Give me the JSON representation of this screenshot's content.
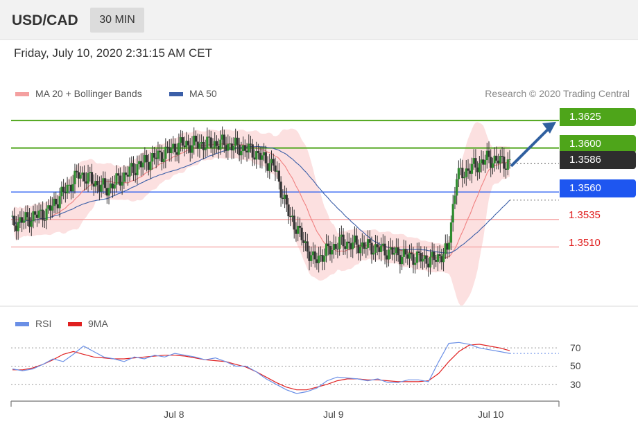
{
  "header": {
    "symbol": "USD/CAD",
    "timeframe": "30 MIN",
    "datetime": "Friday, July 10, 2020 2:31:15 AM CET"
  },
  "legend": {
    "ma20_label": "MA 20 + Bollinger Bands",
    "ma50_label": "MA 50",
    "copyright": "Research © 2020 Trading Central"
  },
  "colors": {
    "up_candle": "#2e8b2e",
    "down_candle": "#333333",
    "bollinger_fill": "#fcdada",
    "ma20": "#f08080",
    "ma50": "#3b5fa8",
    "resistance": "#4ea51a",
    "pivot": "#1e56f0",
    "support": "#f4a0a0",
    "last_price_tag": "#2e2e2e",
    "arrow": "#2f5f9f",
    "rsi": "#6a8fe6",
    "rsi_ma": "#e02020"
  },
  "levels": [
    {
      "label": "1.3625",
      "kind": "resistance"
    },
    {
      "label": "1.3600",
      "kind": "resistance"
    },
    {
      "label": "1.3586",
      "kind": "last"
    },
    {
      "label": "1.3560",
      "kind": "pivot"
    },
    {
      "label": "1.3535",
      "kind": "support"
    },
    {
      "label": "1.3510",
      "kind": "support"
    }
  ],
  "rsi_panel": {
    "rsi_label": "RSI",
    "ma_label": "9MA",
    "ticks": [
      "70",
      "50",
      "30"
    ]
  },
  "x_axis": {
    "ticks": [
      "Jul 8",
      "Jul 9",
      "Jul 10"
    ]
  },
  "chart_data": {
    "type": "candlestick",
    "instrument": "USD/CAD",
    "interval": "30 MIN",
    "ylim": [
      1.347,
      1.3635
    ],
    "levels": {
      "resistance": [
        1.3625,
        1.36
      ],
      "last": 1.3586,
      "pivot": 1.356,
      "support": [
        1.3535,
        1.351
      ]
    },
    "segments": [
      {
        "n": 18,
        "from": 1.3531,
        "to": 1.3541
      },
      {
        "n": 18,
        "from": 1.3541,
        "to": 1.3576
      },
      {
        "n": 14,
        "from": 1.3576,
        "to": 1.3563
      },
      {
        "n": 18,
        "from": 1.3563,
        "to": 1.3585
      },
      {
        "n": 22,
        "from": 1.3585,
        "to": 1.3603
      },
      {
        "n": 22,
        "from": 1.3603,
        "to": 1.3604
      },
      {
        "n": 14,
        "from": 1.3604,
        "to": 1.3598
      },
      {
        "n": 12,
        "from": 1.3598,
        "to": 1.3585
      },
      {
        "n": 10,
        "from": 1.3585,
        "to": 1.3535
      },
      {
        "n": 12,
        "from": 1.3535,
        "to": 1.3498
      },
      {
        "n": 14,
        "from": 1.3498,
        "to": 1.3514
      },
      {
        "n": 16,
        "from": 1.3514,
        "to": 1.351
      },
      {
        "n": 18,
        "from": 1.351,
        "to": 1.3502
      },
      {
        "n": 14,
        "from": 1.3502,
        "to": 1.3498
      },
      {
        "n": 8,
        "from": 1.3498,
        "to": 1.3505
      },
      {
        "n": 6,
        "from": 1.3505,
        "to": 1.3575
      },
      {
        "n": 16,
        "from": 1.3575,
        "to": 1.359
      },
      {
        "n": 12,
        "from": 1.359,
        "to": 1.3586
      }
    ],
    "rsi": {
      "ylim": [
        20,
        80
      ],
      "guides": [
        70,
        50,
        30
      ],
      "rsi_values": [
        47,
        45,
        47,
        52,
        58,
        55,
        63,
        72,
        66,
        60,
        58,
        55,
        60,
        58,
        62,
        60,
        64,
        62,
        60,
        57,
        59,
        55,
        50,
        50,
        44,
        36,
        30,
        24,
        20,
        22,
        26,
        34,
        38,
        37,
        36,
        34,
        36,
        32,
        32,
        35,
        35,
        33,
        55,
        75,
        76,
        74,
        70,
        68,
        66,
        64
      ],
      "ma_values": [
        46,
        46,
        48,
        52,
        57,
        63,
        66,
        63,
        60,
        59,
        58,
        58,
        59,
        60,
        61,
        62,
        62,
        61,
        59,
        57,
        56,
        55,
        52,
        49,
        44,
        38,
        32,
        27,
        24,
        24,
        27,
        30,
        34,
        36,
        36,
        35,
        35,
        34,
        33,
        33,
        33,
        34,
        42,
        55,
        66,
        73,
        74,
        72,
        70,
        67
      ]
    }
  }
}
